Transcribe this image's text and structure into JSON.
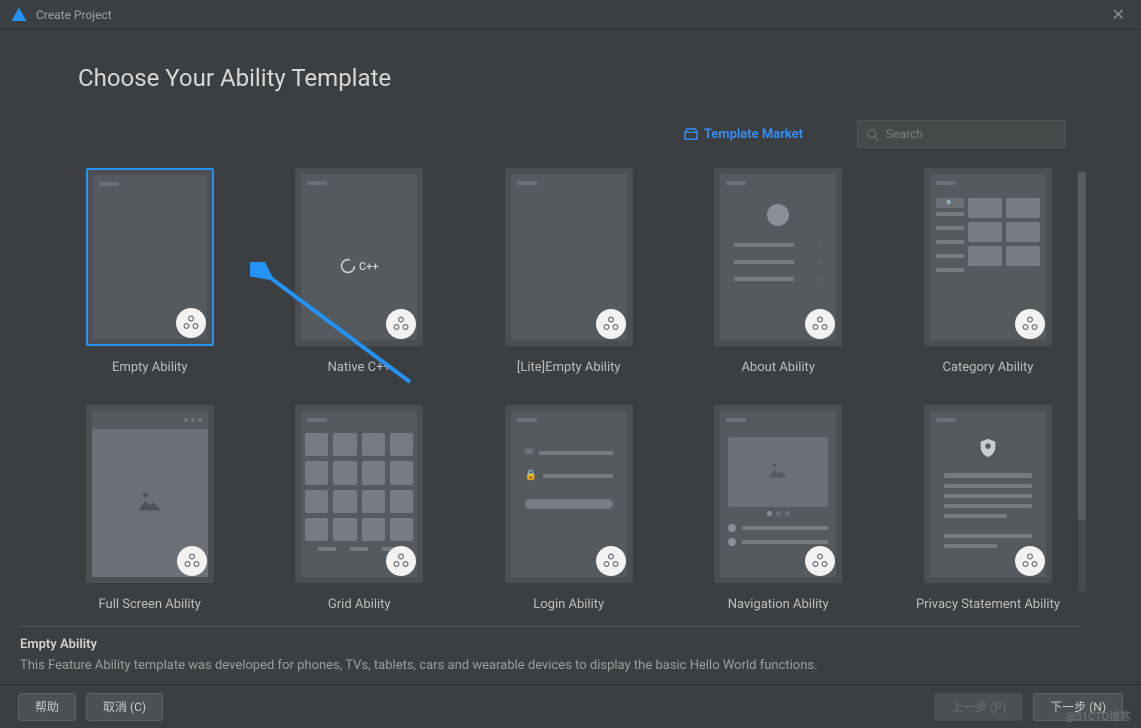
{
  "window": {
    "title": "Create Project"
  },
  "heading": "Choose Your Ability Template",
  "marketLink": "Template Market",
  "search": {
    "placeholder": "Search"
  },
  "templates": [
    {
      "id": "empty",
      "label": "Empty Ability"
    },
    {
      "id": "native-cpp",
      "label": "Native C++"
    },
    {
      "id": "lite-empty",
      "label": "[Lite]Empty Ability"
    },
    {
      "id": "about",
      "label": "About Ability"
    },
    {
      "id": "category",
      "label": "Category Ability"
    },
    {
      "id": "fullscreen",
      "label": "Full Screen Ability"
    },
    {
      "id": "grid",
      "label": "Grid Ability"
    },
    {
      "id": "login",
      "label": "Login Ability"
    },
    {
      "id": "navigation",
      "label": "Navigation Ability"
    },
    {
      "id": "privacy",
      "label": "Privacy Statement Ability"
    }
  ],
  "cpp_label": "C++",
  "description": {
    "title": "Empty Ability",
    "text": "This Feature Ability template was developed for phones, TVs, tablets, cars and wearable devices to display the basic Hello World functions."
  },
  "buttons": {
    "help": "帮助",
    "cancel": "取消 (C)",
    "prev": "上一步 (P)",
    "next": "下一步 (N)"
  },
  "watermark": "@51CTO博客"
}
